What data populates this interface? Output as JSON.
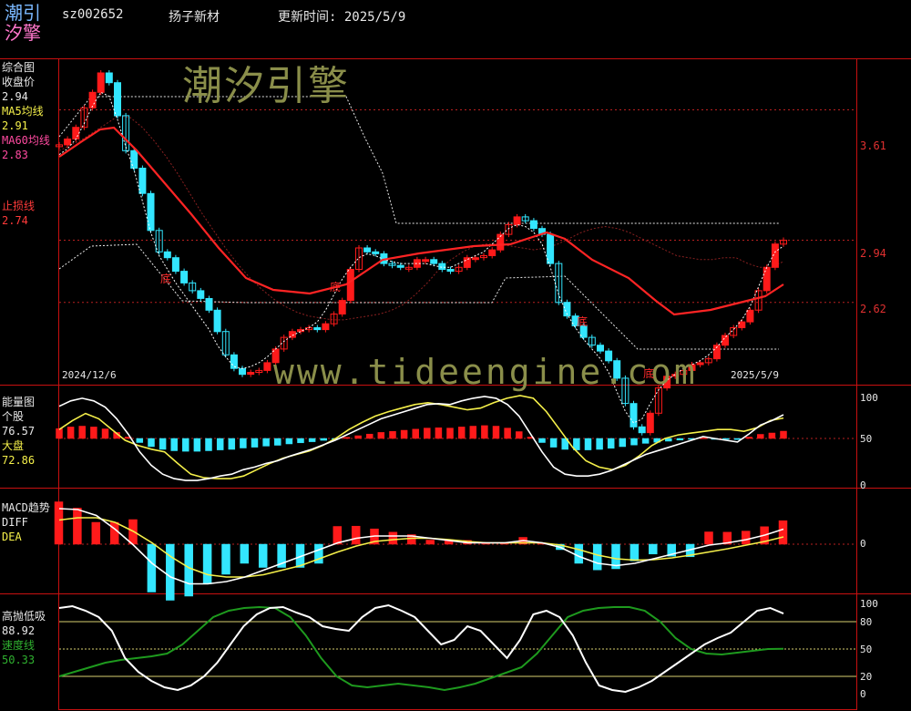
{
  "header": {
    "logo_line1": "潮引",
    "logo_line2": "汐擎",
    "code": "sz002652",
    "name": "扬子新材",
    "update_label": "更新时间: 2025/5/9"
  },
  "watermarks": {
    "brand": "潮汐引擎",
    "url": "www.tideengine.com"
  },
  "colors": {
    "up": "#ff1a1a",
    "down": "#33e6ff",
    "ma5": "#ffffff",
    "ma60": "#ff2424",
    "stop": "#ff4040",
    "yellow": "#f5f04a",
    "green": "#1e9a1e",
    "frame": "#c81010"
  },
  "panels": {
    "main": {
      "t1": "综合图",
      "t2": "收盘价",
      "v2": "2.94",
      "t3": "MA5均线",
      "v3": "2.91",
      "t4": "MA60均线",
      "v4": "2.83",
      "t5": "止损线",
      "v5": "2.74",
      "ticks": [
        "3.61",
        "2.94",
        "2.62"
      ],
      "date_start": "2024/12/6",
      "date_end": "2025/5/9",
      "di": [
        "底",
        "底",
        "底",
        "底"
      ]
    },
    "energy": {
      "t1": "能量图",
      "t2": "个股",
      "v2": "76.57",
      "t3": "大盘",
      "v3": "72.86",
      "ticks": [
        "100",
        "50",
        "0"
      ]
    },
    "macd": {
      "t1": "MACD趋势",
      "t2": "DIFF",
      "t3": "DEA",
      "ticks": [
        "0"
      ]
    },
    "gpdx": {
      "t1": "高抛低吸",
      "v1": "88.92",
      "t2": "速度线",
      "v2": "50.33",
      "ticks": [
        "100",
        "80",
        "50",
        "20",
        "0"
      ]
    }
  },
  "chart_data": [
    {
      "type": "candlestick",
      "title": "综合图",
      "x": [
        "2024/12/6",
        "2025/5/9"
      ],
      "ylim": [
        2.3,
        3.8
      ],
      "series": [
        {
          "name": "收盘价",
          "values": [
            3.43,
            3.46,
            3.52,
            3.62,
            3.7,
            3.8,
            3.75,
            3.58,
            3.4,
            3.31,
            3.18,
            2.99,
            2.88,
            2.85,
            2.78,
            2.72,
            2.68,
            2.64,
            2.58,
            2.47,
            2.35,
            2.28,
            2.25,
            2.26,
            2.27,
            2.31,
            2.38,
            2.44,
            2.47,
            2.48,
            2.49,
            2.48,
            2.51,
            2.56,
            2.63,
            2.79,
            2.9,
            2.88,
            2.87,
            2.82,
            2.81,
            2.8,
            2.8,
            2.84,
            2.84,
            2.82,
            2.79,
            2.78,
            2.8,
            2.85,
            2.85,
            2.86,
            2.89,
            2.97,
            3.02,
            3.06,
            3.04,
            3.0,
            2.97,
            2.82,
            2.62,
            2.55,
            2.5,
            2.44,
            2.4,
            2.37,
            2.32,
            2.23,
            2.1,
            1.98,
            1.95,
            2.05,
            2.18,
            2.24,
            2.25,
            2.27,
            2.3,
            2.31,
            2.33,
            2.4,
            2.45,
            2.49,
            2.52,
            2.58,
            2.68,
            2.8,
            2.92,
            2.94
          ]
        },
        {
          "name": "MA5均线",
          "values": [
            3.38,
            3.41,
            3.46,
            3.54,
            3.63,
            3.7,
            3.68,
            3.56,
            3.42,
            3.3,
            3.14,
            2.98,
            2.86,
            2.79,
            2.72,
            2.66,
            2.6,
            2.54,
            2.48,
            2.4,
            2.34,
            2.29,
            2.28,
            2.29,
            2.31,
            2.34,
            2.38,
            2.42,
            2.45,
            2.47,
            2.49,
            2.52,
            2.58,
            2.66,
            2.74,
            2.8,
            2.85,
            2.87,
            2.86,
            2.84,
            2.83,
            2.82,
            2.82,
            2.82,
            2.82,
            2.81,
            2.8,
            2.8,
            2.82,
            2.84,
            2.86,
            2.88,
            2.92,
            2.96,
            3.0,
            3.02,
            3.01,
            2.98,
            2.92,
            2.8,
            2.66,
            2.56,
            2.49,
            2.43,
            2.38,
            2.33,
            2.26,
            2.16,
            2.06,
            2.0,
            2.02,
            2.1,
            2.17,
            2.22,
            2.25,
            2.28,
            2.3,
            2.32,
            2.35,
            2.39,
            2.44,
            2.48,
            2.53,
            2.6,
            2.7,
            2.8,
            2.88,
            2.91
          ]
        },
        {
          "name": "MA60均线",
          "values": [
            3.4,
            3.43,
            3.46,
            3.5,
            3.54,
            3.58,
            3.57,
            3.52,
            3.45,
            3.37,
            3.28,
            3.18,
            3.08,
            2.99,
            2.9,
            2.82,
            2.75,
            2.69,
            2.64,
            2.6,
            2.57,
            2.55,
            2.54,
            2.53,
            2.53,
            2.54,
            2.55,
            2.56,
            2.58,
            2.61,
            2.66,
            2.72,
            2.79,
            2.84,
            2.88,
            2.91,
            2.92,
            2.92,
            2.91,
            2.9,
            2.89,
            2.9,
            2.92,
            2.95,
            2.98,
            3.0,
            3.01,
            3.0,
            2.98,
            2.95,
            2.92,
            2.89,
            2.86,
            2.85,
            2.84,
            2.84,
            2.85,
            2.85,
            2.82,
            2.8,
            2.8,
            2.83
          ]
        },
        {
          "name": "止损线",
          "values": [
            2.74
          ]
        }
      ]
    },
    {
      "type": "bar+line",
      "title": "能量图",
      "ylim": [
        0,
        100
      ],
      "series": [
        {
          "name": "个股",
          "values": [
            86,
            92,
            95,
            92,
            85,
            72,
            55,
            35,
            20,
            10,
            5,
            3,
            3,
            5,
            8,
            10,
            15,
            18,
            22,
            25,
            30,
            34,
            38,
            43,
            48,
            54,
            60,
            66,
            72,
            76,
            80,
            84,
            88,
            89,
            88,
            92,
            95,
            97,
            95,
            88,
            75,
            55,
            35,
            18,
            10,
            8,
            8,
            10,
            14,
            20,
            26,
            32,
            36,
            40,
            44,
            48,
            52,
            50,
            48,
            46,
            55,
            65,
            70,
            76.57
          ]
        },
        {
          "name": "大盘",
          "values": [
            60,
            70,
            78,
            72,
            60,
            48,
            42,
            38,
            35,
            22,
            10,
            6,
            5,
            5,
            8,
            15,
            22,
            28,
            32,
            36,
            42,
            50,
            60,
            68,
            75,
            80,
            84,
            88,
            90,
            88,
            85,
            82,
            84,
            90,
            95,
            98,
            95,
            80,
            60,
            40,
            25,
            18,
            15,
            20,
            30,
            42,
            50,
            54,
            56,
            58,
            60,
            60,
            58,
            62,
            70,
            72.86
          ]
        }
      ]
    },
    {
      "type": "bar+line",
      "title": "MACD趋势",
      "ylim": [
        -1,
        1
      ],
      "series": [
        {
          "name": "DIFF",
          "values": [
            0.8,
            0.78,
            0.65,
            0.35,
            0.0,
            -0.4,
            -0.7,
            -0.85,
            -0.85,
            -0.8,
            -0.7,
            -0.55,
            -0.4,
            -0.25,
            -0.1,
            0.05,
            0.15,
            0.2,
            0.2,
            0.2,
            0.15,
            0.1,
            0.05,
            0.05,
            0.05,
            0.1,
            0.05,
            -0.05,
            -0.25,
            -0.4,
            -0.45,
            -0.4,
            -0.3,
            -0.2,
            -0.1,
            0.0,
            0.05,
            0.12,
            0.22,
            0.35
          ]
        },
        {
          "name": "DEA",
          "values": [
            0.55,
            0.6,
            0.6,
            0.5,
            0.3,
            0.05,
            -0.25,
            -0.5,
            -0.65,
            -0.7,
            -0.7,
            -0.65,
            -0.55,
            -0.45,
            -0.3,
            -0.15,
            -0.02,
            0.08,
            0.12,
            0.15,
            0.15,
            0.12,
            0.08,
            0.05,
            0.05,
            0.05,
            0.05,
            0.0,
            -0.1,
            -0.22,
            -0.3,
            -0.33,
            -0.32,
            -0.28,
            -0.22,
            -0.15,
            -0.08,
            0.0,
            0.08,
            0.18
          ]
        }
      ]
    },
    {
      "type": "line",
      "title": "高抛低吸",
      "ylim": [
        0,
        100
      ],
      "series": [
        {
          "name": "高抛低吸",
          "values": [
            95,
            97,
            92,
            85,
            70,
            40,
            25,
            15,
            8,
            5,
            10,
            20,
            35,
            55,
            75,
            88,
            95,
            96,
            90,
            85,
            75,
            72,
            70,
            85,
            95,
            98,
            92,
            85,
            70,
            55,
            60,
            75,
            70,
            55,
            40,
            60,
            88,
            92,
            85,
            65,
            35,
            10,
            5,
            3,
            8,
            15,
            25,
            35,
            45,
            55,
            62,
            68,
            80,
            92,
            95,
            88.92
          ]
        },
        {
          "name": "速度线",
          "values": [
            20,
            25,
            30,
            35,
            38,
            40,
            42,
            45,
            55,
            70,
            85,
            92,
            95,
            96,
            95,
            85,
            65,
            40,
            20,
            10,
            8,
            10,
            12,
            10,
            8,
            5,
            8,
            12,
            18,
            24,
            30,
            45,
            65,
            85,
            92,
            95,
            96,
            96,
            92,
            80,
            62,
            50,
            45,
            44,
            46,
            48,
            50,
            50.33
          ]
        }
      ]
    }
  ]
}
